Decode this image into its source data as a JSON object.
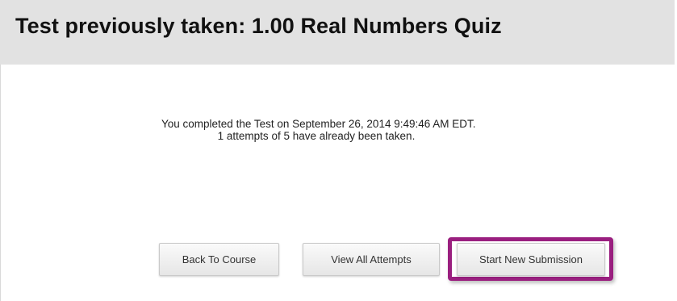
{
  "header": {
    "title": "Test previously taken: 1.00 Real Numbers Quiz"
  },
  "message": {
    "line1": "You completed the Test on September 26, 2014 9:49:46 AM EDT.",
    "line2": "1 attempts of 5 have already been taken."
  },
  "buttons": {
    "back_label": "Back To Course",
    "view_label": "View All Attempts",
    "start_label": "Start New Submission"
  },
  "colors": {
    "header_background": "#e2e2e2",
    "highlight_border": "#9a1f7f"
  }
}
